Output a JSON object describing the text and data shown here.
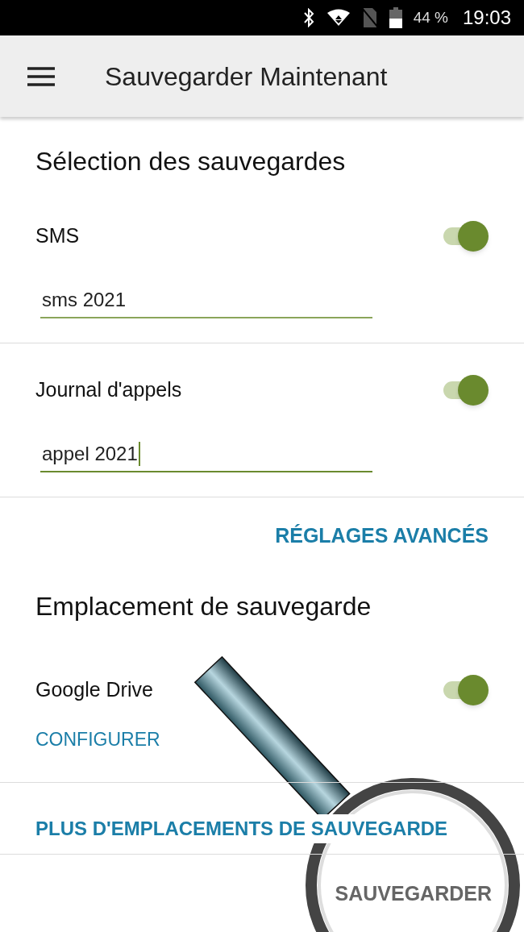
{
  "status_bar": {
    "battery": "44 %",
    "time": "19:03"
  },
  "app_bar": {
    "title": "Sauvegarder Maintenant"
  },
  "selection": {
    "heading": "Sélection des sauvegardes",
    "items": [
      {
        "label": "SMS",
        "on": true,
        "field_value": "sms 2021",
        "focused": false
      },
      {
        "label": "Journal d'appels",
        "on": true,
        "field_value": "appel 2021",
        "focused": true
      }
    ],
    "advanced_link": "RÉGLAGES AVANCÉS"
  },
  "location": {
    "heading": "Emplacement de sauvegarde",
    "items": [
      {
        "label": "Google Drive",
        "on": true,
        "action": "CONFIGURER"
      }
    ],
    "more_link": "PLUS D'EMPLACEMENTS DE SAUVEGARDE"
  },
  "save_button": "SAUVEGARDER"
}
